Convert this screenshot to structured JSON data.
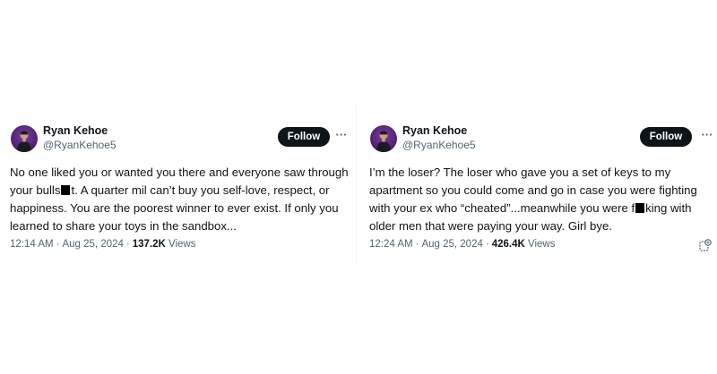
{
  "tweets": [
    {
      "author_name": "Ryan Kehoe",
      "author_handle": "@RyanKehoe5",
      "follow_label": "Follow",
      "more_glyph": "···",
      "text_lines": [
        {
          "a": "No one liked you or wanted you there and everyone saw through",
          "b": ""
        },
        {
          "a": "your bulls",
          "b": "t. A quarter mil can’t buy you self-love, respect, or"
        },
        {
          "a": "happiness. You are the poorest winner to ever exist. If only you",
          "b": ""
        },
        {
          "a": "learned to share your toys in the sandbox...",
          "b": ""
        }
      ],
      "time": "12:14 AM",
      "date": "Aug 25, 2024",
      "views_count": "137.2K",
      "views_label": "Views"
    },
    {
      "author_name": "Ryan Kehoe",
      "author_handle": "@RyanKehoe5",
      "follow_label": "Follow",
      "more_glyph": "···",
      "text_lines": [
        {
          "a": "I’m the loser? The loser who gave you a set of keys to my",
          "b": ""
        },
        {
          "a": "apartment so you could  come and go in case you were fighting",
          "b": ""
        },
        {
          "a": "with your ex who “cheated”...meanwhile you were f",
          "b": "king with"
        },
        {
          "a": "older men that were paying your way. Girl bye.",
          "b": ""
        }
      ],
      "time": "12:24 AM",
      "date": "Aug 25, 2024",
      "views_count": "426.4K",
      "views_label": "Views"
    }
  ],
  "separator": "·",
  "icons": {
    "more": "more-horizontal-icon",
    "grok": "grok-explain-icon",
    "redaction": "redaction-box"
  }
}
